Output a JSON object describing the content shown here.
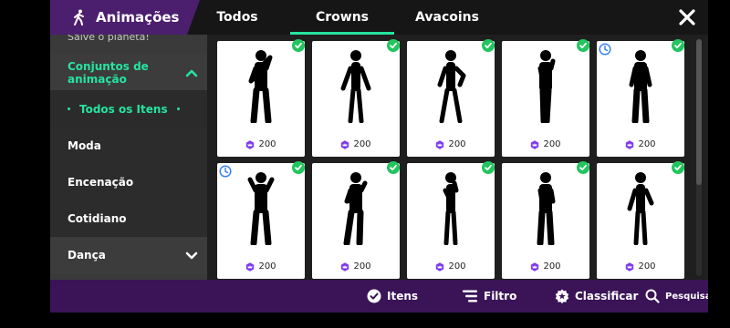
{
  "header": {
    "title": "Animações",
    "tabs": [
      "Todos",
      "Crowns",
      "Avacoins"
    ],
    "active_tab": "Crowns"
  },
  "sidebar": {
    "cut_item": "Salve o planeta!",
    "items": [
      {
        "label": "Conjuntos de animação",
        "expanded": true
      },
      {
        "label": "Todos os Itens",
        "selected": true
      },
      {
        "label": "Moda"
      },
      {
        "label": "Encenação"
      },
      {
        "label": "Cotidiano"
      },
      {
        "label": "Dança",
        "expanded": false
      }
    ]
  },
  "cards": [
    {
      "price": "200",
      "owned": true,
      "limited": false
    },
    {
      "price": "200",
      "owned": true,
      "limited": false
    },
    {
      "price": "200",
      "owned": true,
      "limited": false
    },
    {
      "price": "200",
      "owned": true,
      "limited": false
    },
    {
      "price": "200",
      "owned": true,
      "limited": true
    },
    {
      "price": "200",
      "owned": true,
      "limited": true
    },
    {
      "price": "200",
      "owned": true,
      "limited": false
    },
    {
      "price": "200",
      "owned": true,
      "limited": false
    },
    {
      "price": "200",
      "owned": true,
      "limited": false
    },
    {
      "price": "200",
      "owned": true,
      "limited": false
    }
  ],
  "bottom_bar": {
    "itens": "Itens",
    "filtro": "Filtro",
    "classificar": "Classificar",
    "pesquisa": "Pesquisa"
  },
  "colors": {
    "accent": "#26e3a0",
    "brand_purple": "#4b1f6e",
    "bottom_purple": "#3a1457",
    "owned_check": "#22c55e",
    "clock": "#3b82f6",
    "coin": "#7c3aed"
  },
  "icons": {
    "title": "walking-figure-icon",
    "close": "close-icon",
    "itens": "check-circle-icon",
    "filtro": "filter-icon",
    "classificar": "badge-star-icon",
    "pesquisa": "search-icon",
    "price": "crown-coin-icon"
  }
}
